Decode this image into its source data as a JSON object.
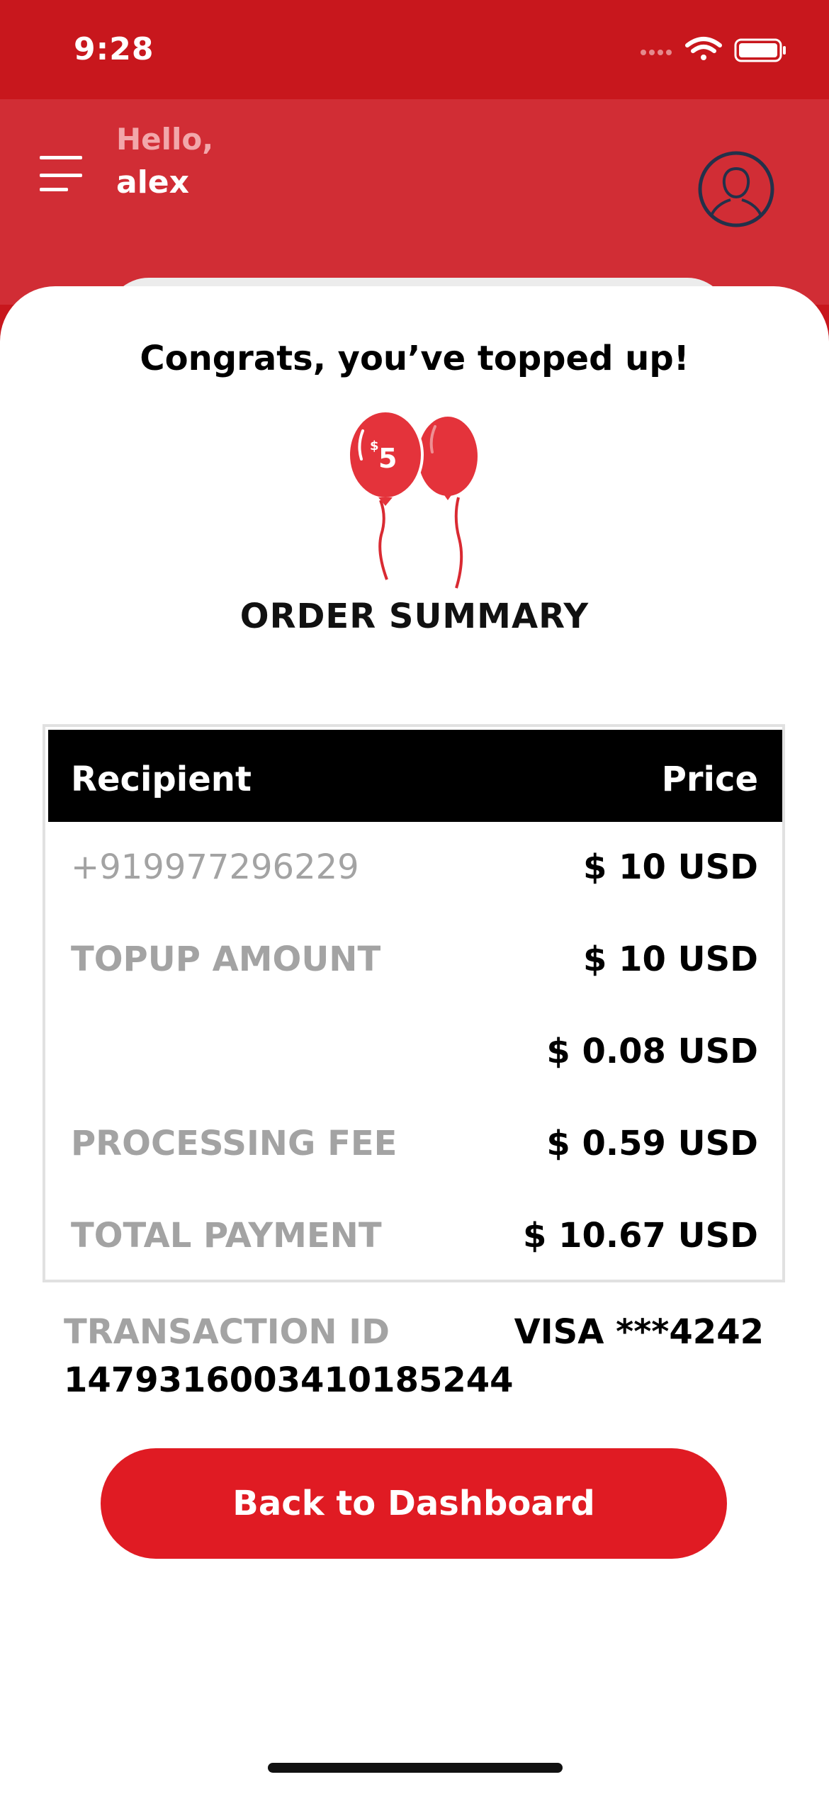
{
  "status_bar": {
    "time": "9:28",
    "icons": [
      "signal-dots-icon",
      "wifi-icon",
      "battery-icon"
    ]
  },
  "header": {
    "greeting": "Hello,",
    "username": "alex",
    "menu_icon": "hamburger-menu-icon",
    "avatar_icon": "user-avatar-icon"
  },
  "congrats": {
    "title": "Congrats, you’ve topped up!",
    "balloon_label_symbol": "$",
    "balloon_label_value": "5"
  },
  "summary": {
    "title": "ORDER SUMMARY",
    "columns": [
      "Recipient",
      "Price"
    ],
    "rows": [
      {
        "label": "+919977296229",
        "value": "$ 10 USD"
      },
      {
        "label": "TOPUP AMOUNT",
        "value": "$ 10 USD"
      },
      {
        "label": "",
        "value": "$ 0.08 USD"
      },
      {
        "label": "PROCESSING FEE",
        "value": "$ 0.59 USD"
      },
      {
        "label": "TOTAL PAYMENT",
        "value": "$ 10.67 USD"
      }
    ]
  },
  "transaction": {
    "label": "TRANSACTION ID",
    "id": "1479316003410185244",
    "card": "VISA ***4242"
  },
  "actions": {
    "back_label": "Back to Dashboard"
  },
  "colors": {
    "status_bar": "#c8171d",
    "header": "#d12d35",
    "accent": "#e01b23",
    "table_head": "#000000",
    "muted_text": "#a3a3a3"
  }
}
